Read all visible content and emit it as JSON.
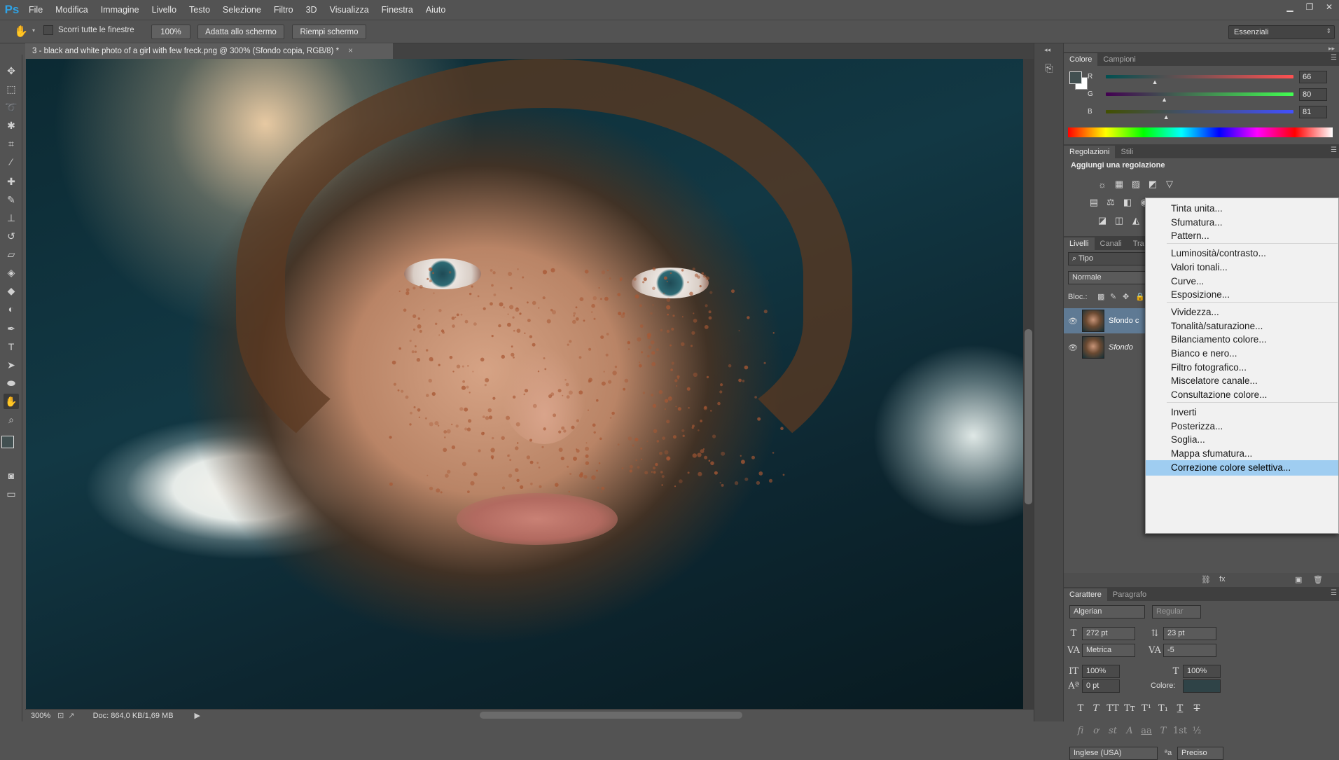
{
  "app": {
    "logo": "Ps"
  },
  "menubar": [
    "File",
    "Modifica",
    "Immagine",
    "Livello",
    "Testo",
    "Selezione",
    "Filtro",
    "3D",
    "Visualizza",
    "Finestra",
    "Aiuto"
  ],
  "window_controls": [
    "minimize-icon",
    "restore-icon",
    "close-icon"
  ],
  "options_bar": {
    "scroll_all_label": "Scorri tutte le finestre",
    "zoom_100": "100%",
    "fit_screen": "Adatta allo schermo",
    "fill_screen": "Riempi schermo",
    "workspace": "Essenziali"
  },
  "document": {
    "tab_title": "3 - black and white photo of a girl with few freck.png @ 300% (Sfondo copia, RGB/8) *",
    "close_symbol": "×"
  },
  "status": {
    "zoom": "300%",
    "doc": "Doc: 864,0 KB/1,69 MB"
  },
  "color_panel": {
    "tabs": [
      "Colore",
      "Campioni"
    ],
    "r_label": "R",
    "g_label": "G",
    "b_label": "B",
    "r": "66",
    "g": "80",
    "b": "81",
    "r_level": 0.26,
    "g_level": 0.31,
    "b_level": 0.32,
    "foreground": "#425051"
  },
  "adjustments_panel": {
    "tabs": [
      "Regolazioni",
      "Stili"
    ],
    "heading": "Aggiungi una regolazione"
  },
  "layers_panel": {
    "tabs": [
      "Livelli",
      "Canali",
      "Tra"
    ],
    "filter": "Tipo",
    "blend": "Normale",
    "lock_label": "Bloc.:",
    "layers": [
      {
        "name": "Sfondo c",
        "selected": true
      },
      {
        "name": "Sfondo",
        "selected": false
      }
    ]
  },
  "adjustment_menu": {
    "groups": [
      [
        "Tinta unita...",
        "Sfumatura...",
        "Pattern..."
      ],
      [
        "Luminosità/contrasto...",
        "Valori tonali...",
        "Curve...",
        "Esposizione..."
      ],
      [
        "Vividezza...",
        "Tonalità/saturazione...",
        "Bilanciamento colore...",
        "Bianco e nero...",
        "Filtro fotografico...",
        "Miscelatore canale...",
        "Consultazione colore..."
      ],
      [
        "Inverti",
        "Posterizza...",
        "Soglia...",
        "Mappa sfumatura...",
        "Correzione colore selettiva..."
      ]
    ],
    "highlighted": "Correzione colore selettiva..."
  },
  "character_panel": {
    "tabs": [
      "Carattere",
      "Paragrafo"
    ],
    "font_family": "Algerian",
    "font_style": "Regular",
    "size": "272 pt",
    "leading": "23 pt",
    "kerning": "Metrica",
    "tracking": "-5",
    "vscale": "100%",
    "hscale": "100%",
    "baseline": "0 pt",
    "color_label": "Colore:",
    "color": "#2f4347",
    "language": "Inglese (USA)",
    "antialias": "Preciso",
    "aa_label": "ªa",
    "style_glyphs": [
      "T",
      "T",
      "TT",
      "Tт",
      "T¹",
      "T₁",
      "T",
      "T"
    ],
    "ot_glyphs": [
      "fi",
      "ơ",
      "st",
      "A",
      "aa",
      "T",
      "1st",
      "½"
    ]
  }
}
